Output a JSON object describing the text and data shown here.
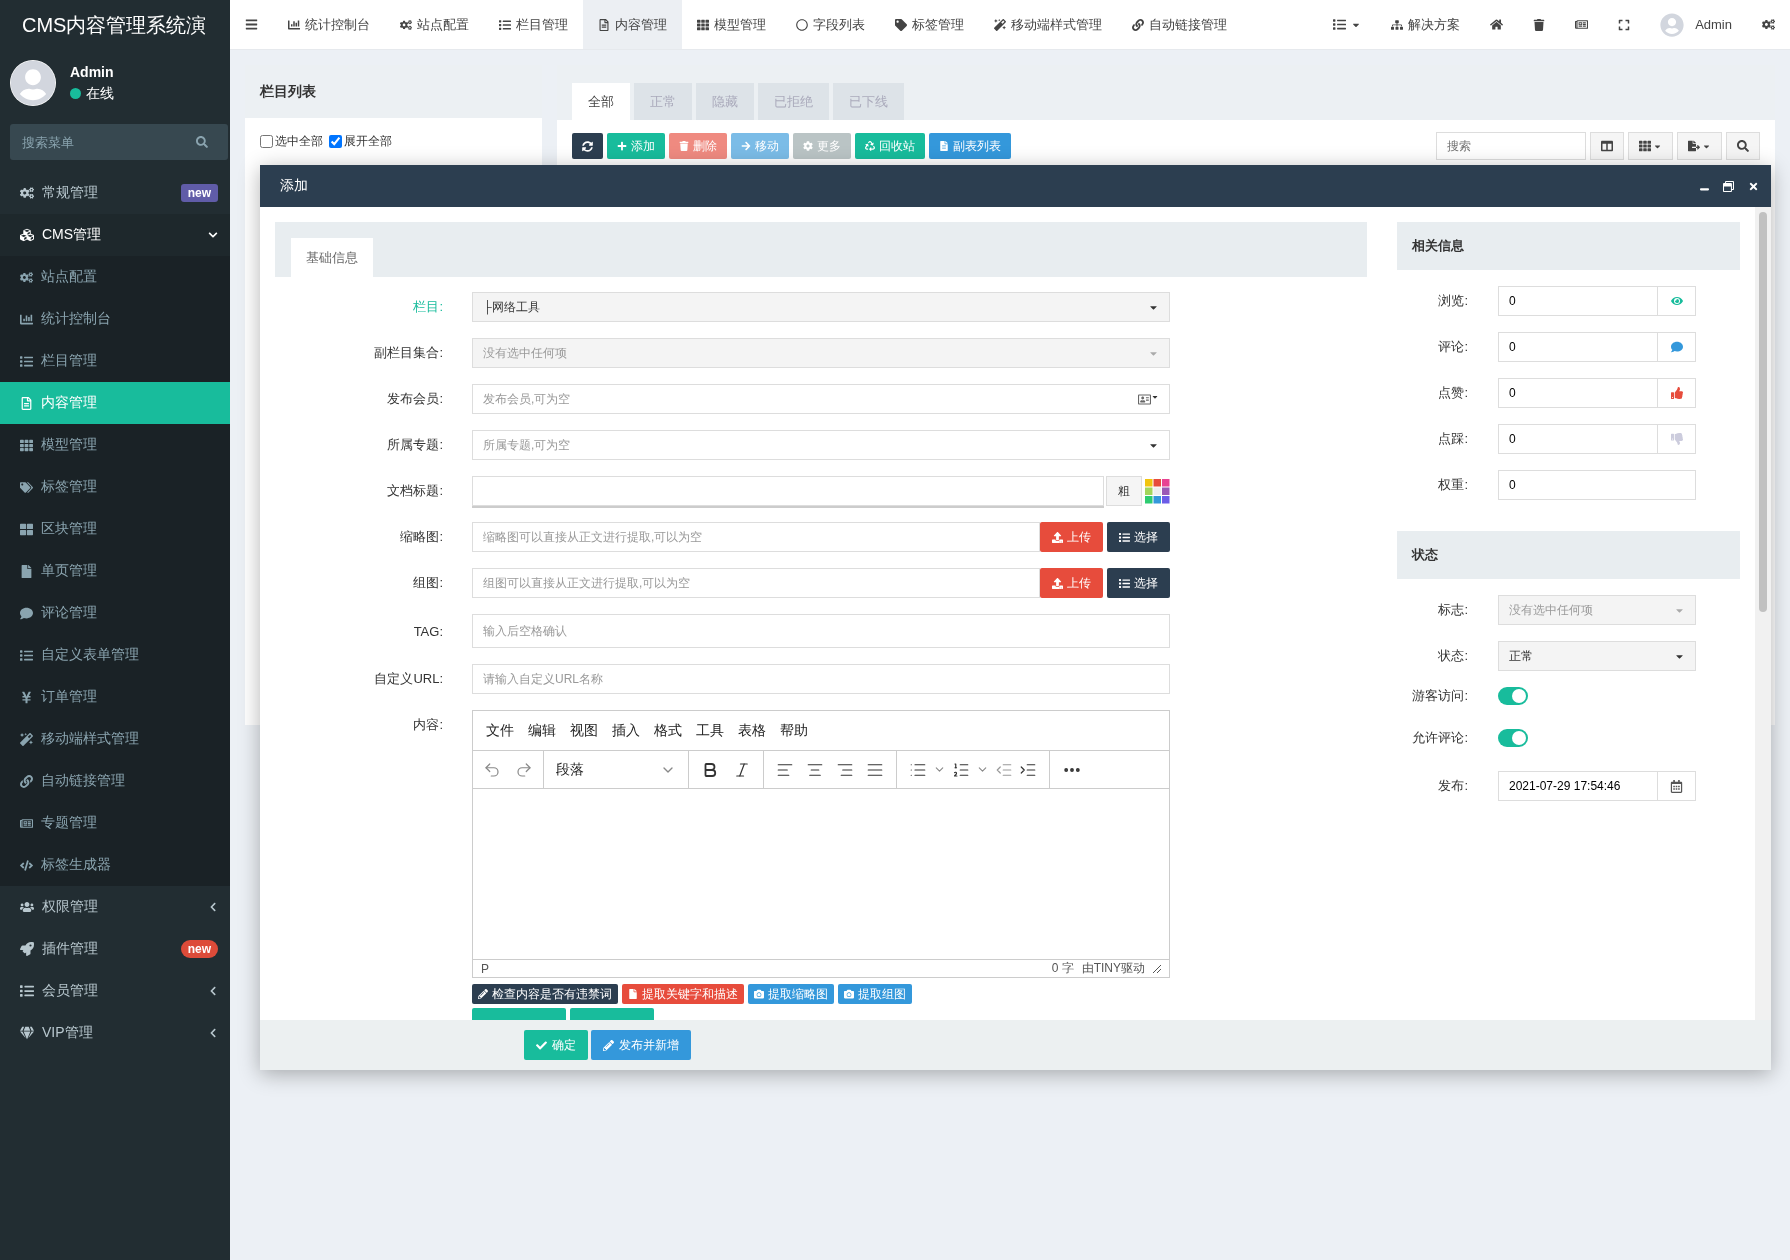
{
  "brand": "CMS内容管理系统演",
  "user": {
    "name": "Admin",
    "status": "在线"
  },
  "sidebar": {
    "search": {
      "placeholder": "搜索菜单"
    },
    "items": [
      {
        "label": "常规管理",
        "badge": "new",
        "color": "#605ca8"
      },
      {
        "label": "CMS管理",
        "expanded": true,
        "children": [
          {
            "label": "站点配置",
            "selected": false
          },
          {
            "label": "统计控制台",
            "selected": false
          },
          {
            "label": "栏目管理",
            "selected": false
          },
          {
            "label": "内容管理",
            "selected": true
          },
          {
            "label": "模型管理",
            "selected": false
          },
          {
            "label": "标签管理",
            "selected": false
          },
          {
            "label": "区块管理",
            "selected": false
          },
          {
            "label": "单页管理",
            "selected": false
          },
          {
            "label": "评论管理",
            "selected": false
          },
          {
            "label": "自定义表单管理",
            "selected": false
          },
          {
            "label": "订单管理",
            "selected": false
          },
          {
            "label": "移动端样式管理",
            "selected": false
          },
          {
            "label": "自动链接管理",
            "selected": false
          },
          {
            "label": "专题管理",
            "selected": false
          },
          {
            "label": "标签生成器",
            "selected": false
          }
        ]
      },
      {
        "label": "权限管理",
        "expanded": false
      },
      {
        "label": "插件管理",
        "badge": "new",
        "color": "#dd4b39"
      },
      {
        "label": "会员管理",
        "expanded": false
      },
      {
        "label": "VIP管理",
        "expanded": false
      }
    ]
  },
  "navbar": {
    "items": [
      {
        "label": "统计控制台",
        "selected": false
      },
      {
        "label": "站点配置",
        "selected": false
      },
      {
        "label": "栏目管理",
        "selected": false
      },
      {
        "label": "内容管理",
        "selected": true
      },
      {
        "label": "模型管理",
        "selected": false
      },
      {
        "label": "字段列表",
        "selected": false
      },
      {
        "label": "标签管理",
        "selected": false
      },
      {
        "label": "移动端样式管理",
        "selected": false
      },
      {
        "label": "自动链接管理",
        "selected": false
      }
    ],
    "solutions": "解决方案",
    "user": "Admin"
  },
  "category_panel": {
    "title": "栏目列表",
    "options": [
      {
        "label": "选中全部",
        "checked": false
      },
      {
        "label": "展开全部",
        "checked": true
      }
    ]
  },
  "content_panel": {
    "tabs": [
      {
        "label": "全部",
        "selected": true
      },
      {
        "label": "正常",
        "selected": false
      },
      {
        "label": "隐藏",
        "selected": false
      },
      {
        "label": "已拒绝",
        "selected": false
      },
      {
        "label": "已下线",
        "selected": false
      }
    ],
    "toolbar": [
      {
        "label": "添加",
        "color": "#18bc9c"
      },
      {
        "label": "删除",
        "color": "#ef8a80"
      },
      {
        "label": "移动",
        "color": "#7bbce7"
      },
      {
        "label": "更多",
        "color": "#bac4c5"
      },
      {
        "label": "回收站",
        "color": "#18bc9c"
      },
      {
        "label": "副表列表",
        "color": "#3498db"
      }
    ],
    "search": {
      "placeholder": "搜索"
    }
  },
  "dialog": {
    "title": "添加",
    "tabs": [
      {
        "label": "基础信息",
        "selected": true
      }
    ],
    "fields": [
      {
        "label": "栏目:",
        "kind": "select",
        "highlighted": true,
        "value": "├网络工具"
      },
      {
        "label": "副栏目集合:",
        "kind": "select",
        "highlighted": false,
        "placeholder": "没有选中任何项"
      },
      {
        "label": "发布会员:",
        "kind": "member",
        "highlighted": false,
        "placeholder": "发布会员,可为空"
      },
      {
        "label": "所属专题:",
        "kind": "selectpage",
        "highlighted": false,
        "placeholder": "所属专题,可为空"
      },
      {
        "label": "文档标题:",
        "kind": "title",
        "highlighted": false,
        "bold_label": "粗"
      },
      {
        "label": "缩略图:",
        "kind": "upload",
        "highlighted": false,
        "placeholder": "缩略图可以直接从正文进行提取,可以为空",
        "buttons": [
          "上传",
          "选择"
        ]
      },
      {
        "label": "组图:",
        "kind": "upload",
        "highlighted": false,
        "placeholder": "组图可以直接从正文进行提取,可以为空",
        "buttons": [
          "上传",
          "选择"
        ]
      },
      {
        "label": "TAG:",
        "kind": "text",
        "highlighted": false,
        "placeholder": "输入后空格确认"
      },
      {
        "label": "自定义URL:",
        "kind": "text",
        "highlighted": false,
        "placeholder": "请输入自定义URL名称"
      },
      {
        "label": "内容:",
        "kind": "editor",
        "highlighted": false
      }
    ],
    "editor": {
      "menu": [
        "文件",
        "编辑",
        "视图",
        "插入",
        "格式",
        "工具",
        "表格",
        "帮助"
      ],
      "block_format": "段落",
      "path": "P",
      "word_count": "0 字",
      "powered_by": "由TINY驱动"
    },
    "actions": [
      {
        "label": "检查内容是否有违禁词",
        "color": "#2c3e50"
      },
      {
        "label": "提取关键字和描述",
        "color": "#e74c3c"
      },
      {
        "label": "提取缩略图",
        "color": "#3498db"
      },
      {
        "label": "提取组图",
        "color": "#3498db"
      }
    ],
    "more_actions": [
      {
        "color": "#18bc9c"
      },
      {
        "color": "#18bc9c"
      }
    ],
    "related": {
      "title": "相关信息",
      "fields": [
        {
          "label": "浏览:",
          "kind": "counter",
          "value": "0"
        },
        {
          "label": "评论:",
          "kind": "counter",
          "value": "0"
        },
        {
          "label": "点赞:",
          "kind": "counter",
          "value": "0"
        },
        {
          "label": "点踩:",
          "kind": "counter",
          "value": "0"
        },
        {
          "label": "权重:",
          "kind": "number",
          "value": "0"
        }
      ]
    },
    "status": {
      "title": "状态",
      "fields": [
        {
          "label": "标志:",
          "kind": "select",
          "placeholder": "没有选中任何项"
        },
        {
          "label": "状态:",
          "kind": "select",
          "value": "正常"
        },
        {
          "label": "游客访问:",
          "kind": "switch",
          "on": true
        },
        {
          "label": "允许评论:",
          "kind": "switch",
          "on": true
        },
        {
          "label": "发布:",
          "kind": "datetime",
          "value": "2021-07-29 17:54:46"
        }
      ]
    },
    "footer": [
      {
        "label": "确定",
        "color": "#18bc9c"
      },
      {
        "label": "发布并新增",
        "color": "#3498db"
      }
    ]
  }
}
